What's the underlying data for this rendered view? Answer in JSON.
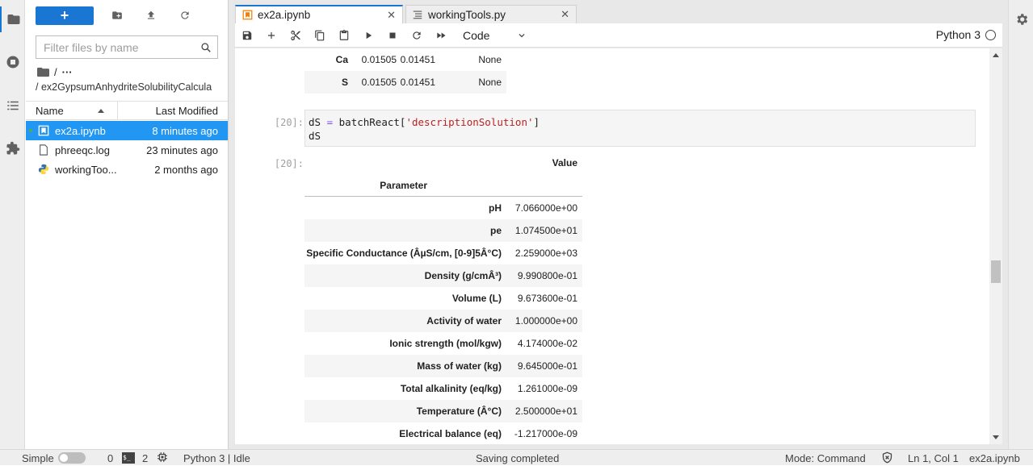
{
  "activity_bar": {
    "icons": [
      "folder-icon",
      "running-icon",
      "toc-icon",
      "extension-icon"
    ]
  },
  "file_browser": {
    "new_label": "+",
    "search_placeholder": "Filter files by name",
    "breadcrumb_root": "/",
    "breadcrumb_more": "···",
    "breadcrumb_path": "/ ex2GypsumAnhydriteSolubilityCalcula",
    "col_name": "Name",
    "col_modified": "Last Modified",
    "files": [
      {
        "name": "ex2a.ipynb",
        "modified": "8 minutes ago",
        "icon": "notebook-icon",
        "selected": true
      },
      {
        "name": "phreeqc.log",
        "modified": "23 minutes ago",
        "icon": "file-icon",
        "selected": false
      },
      {
        "name": "workingToo...",
        "modified": "2 months ago",
        "icon": "python-icon",
        "selected": false
      }
    ]
  },
  "tabs": [
    {
      "label": "ex2a.ipynb",
      "icon": "notebook-icon",
      "close": "✕"
    },
    {
      "label": "workingTools.py",
      "icon": "text-file-icon",
      "close": "✕"
    }
  ],
  "notebook_toolbar": {
    "cell_type": "Code",
    "kernel_name": "Python 3"
  },
  "top_table": {
    "rows": [
      [
        "Ca",
        "0.01505",
        "0.01451",
        "None"
      ],
      [
        "S",
        "0.01505",
        "0.01451",
        "None"
      ]
    ]
  },
  "cell20": {
    "prompt_in": "[20]:",
    "line1_var": "dS",
    "line1_op": "=",
    "line1_call": "batchReact[",
    "line1_str": "'descriptionSolution'",
    "line1_end": "]",
    "line2": "dS",
    "prompt_out": "[20]:"
  },
  "param_table": {
    "value_header": "Value",
    "index_header": "Parameter",
    "rows": [
      [
        "pH",
        "7.066000e+00"
      ],
      [
        "pe",
        "1.074500e+01"
      ],
      [
        "Specific Conductance (ÂµS/cm, [0-9]5Â°C)",
        "2.259000e+03"
      ],
      [
        "Density (g/cmÂ³)",
        "9.990800e-01"
      ],
      [
        "Volume (L)",
        "9.673600e-01"
      ],
      [
        "Activity of water",
        "1.000000e+00"
      ],
      [
        "Ionic strength (mol/kgw)",
        "4.174000e-02"
      ],
      [
        "Mass of water (kg)",
        "9.645000e-01"
      ],
      [
        "Total alkalinity (eq/kg)",
        "1.261000e-09"
      ],
      [
        "Temperature (Â°C)",
        "2.500000e+01"
      ],
      [
        "Electrical balance (eq)",
        "-1.217000e-09"
      ]
    ]
  },
  "status_bar": {
    "mode_simple": "Simple",
    "terminals_count": "0",
    "terminal_glyph": "$_",
    "kernels_count": "2",
    "kernel_status": "Python 3 | Idle",
    "saving": "Saving completed",
    "mode": "Mode: Command",
    "cursor": "Ln 1, Col 1",
    "filename": "ex2a.ipynb"
  }
}
